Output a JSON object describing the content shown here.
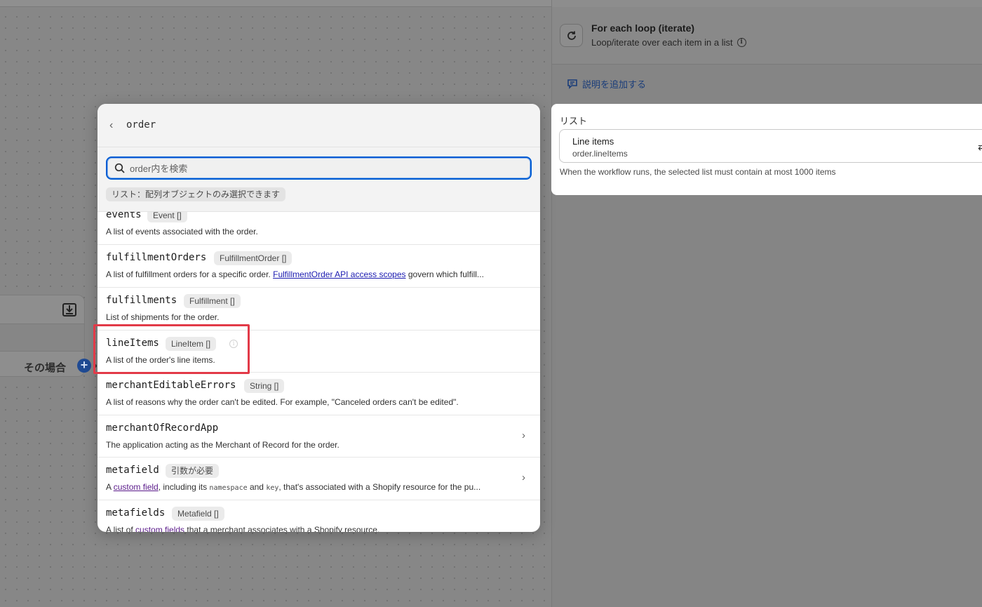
{
  "canvas": {
    "node_label": "その場合",
    "icons": [
      "download-icon",
      "plus-icon"
    ]
  },
  "right_panel": {
    "title": "For each loop (iterate)",
    "subtitle": "Loop/iterate over each item in a list",
    "add_description": "説明を追加する",
    "list_label": "リスト",
    "field_title": "Line items",
    "field_path": "order.lineItems",
    "help_text": "When the workflow runs, the selected list must contain at most 1000 items",
    "icons": [
      "refresh-icon",
      "info-icon",
      "comment-icon",
      "swap-icon"
    ]
  },
  "popover": {
    "title": "order",
    "search_placeholder": "order内を検索",
    "filter_note": "リスト：配列オブジェクトのみ選択できます",
    "fields": [
      {
        "name": "events",
        "type": "Event []",
        "desc": "A list of events associated with the order."
      },
      {
        "name": "fulfillmentOrders",
        "type": "FulfillmentOrder []",
        "desc_pre": "A list of fulfillment orders for a specific order. ",
        "desc_link": "FulfillmentOrder API access scopes",
        "desc_post": " govern which fulfill..."
      },
      {
        "name": "fulfillments",
        "type": "Fulfillment []",
        "desc": "List of shipments for the order."
      },
      {
        "name": "lineItems",
        "type": "LineItem []",
        "desc": "A list of the order's line items."
      },
      {
        "name": "merchantEditableErrors",
        "type": "String []",
        "desc": "A list of reasons why the order can't be edited. For example, \"Canceled orders can't be edited\"."
      },
      {
        "name": "merchantOfRecordApp",
        "desc": "The application acting as the Merchant of Record for the order."
      },
      {
        "name": "metafield",
        "type": "引数が必要",
        "desc_pre": "A ",
        "desc_link": "custom field",
        "desc_mid": ", including its ",
        "desc_code1": "namespace",
        "desc_and": " and ",
        "desc_code2": "key",
        "desc_post": ", that's associated with a Shopify resource for the pu..."
      },
      {
        "name": "metafields",
        "type": "Metafield []",
        "desc_pre": "A list of ",
        "desc_link": "custom fields",
        "desc_post": " that a merchant associates with a Shopify resource."
      }
    ],
    "icons": [
      "back-chevron-icon",
      "search-icon",
      "chevron-right-icon",
      "info-icon"
    ],
    "colors": {
      "focus": "#005bd3",
      "highlight": "#e23a48"
    }
  }
}
